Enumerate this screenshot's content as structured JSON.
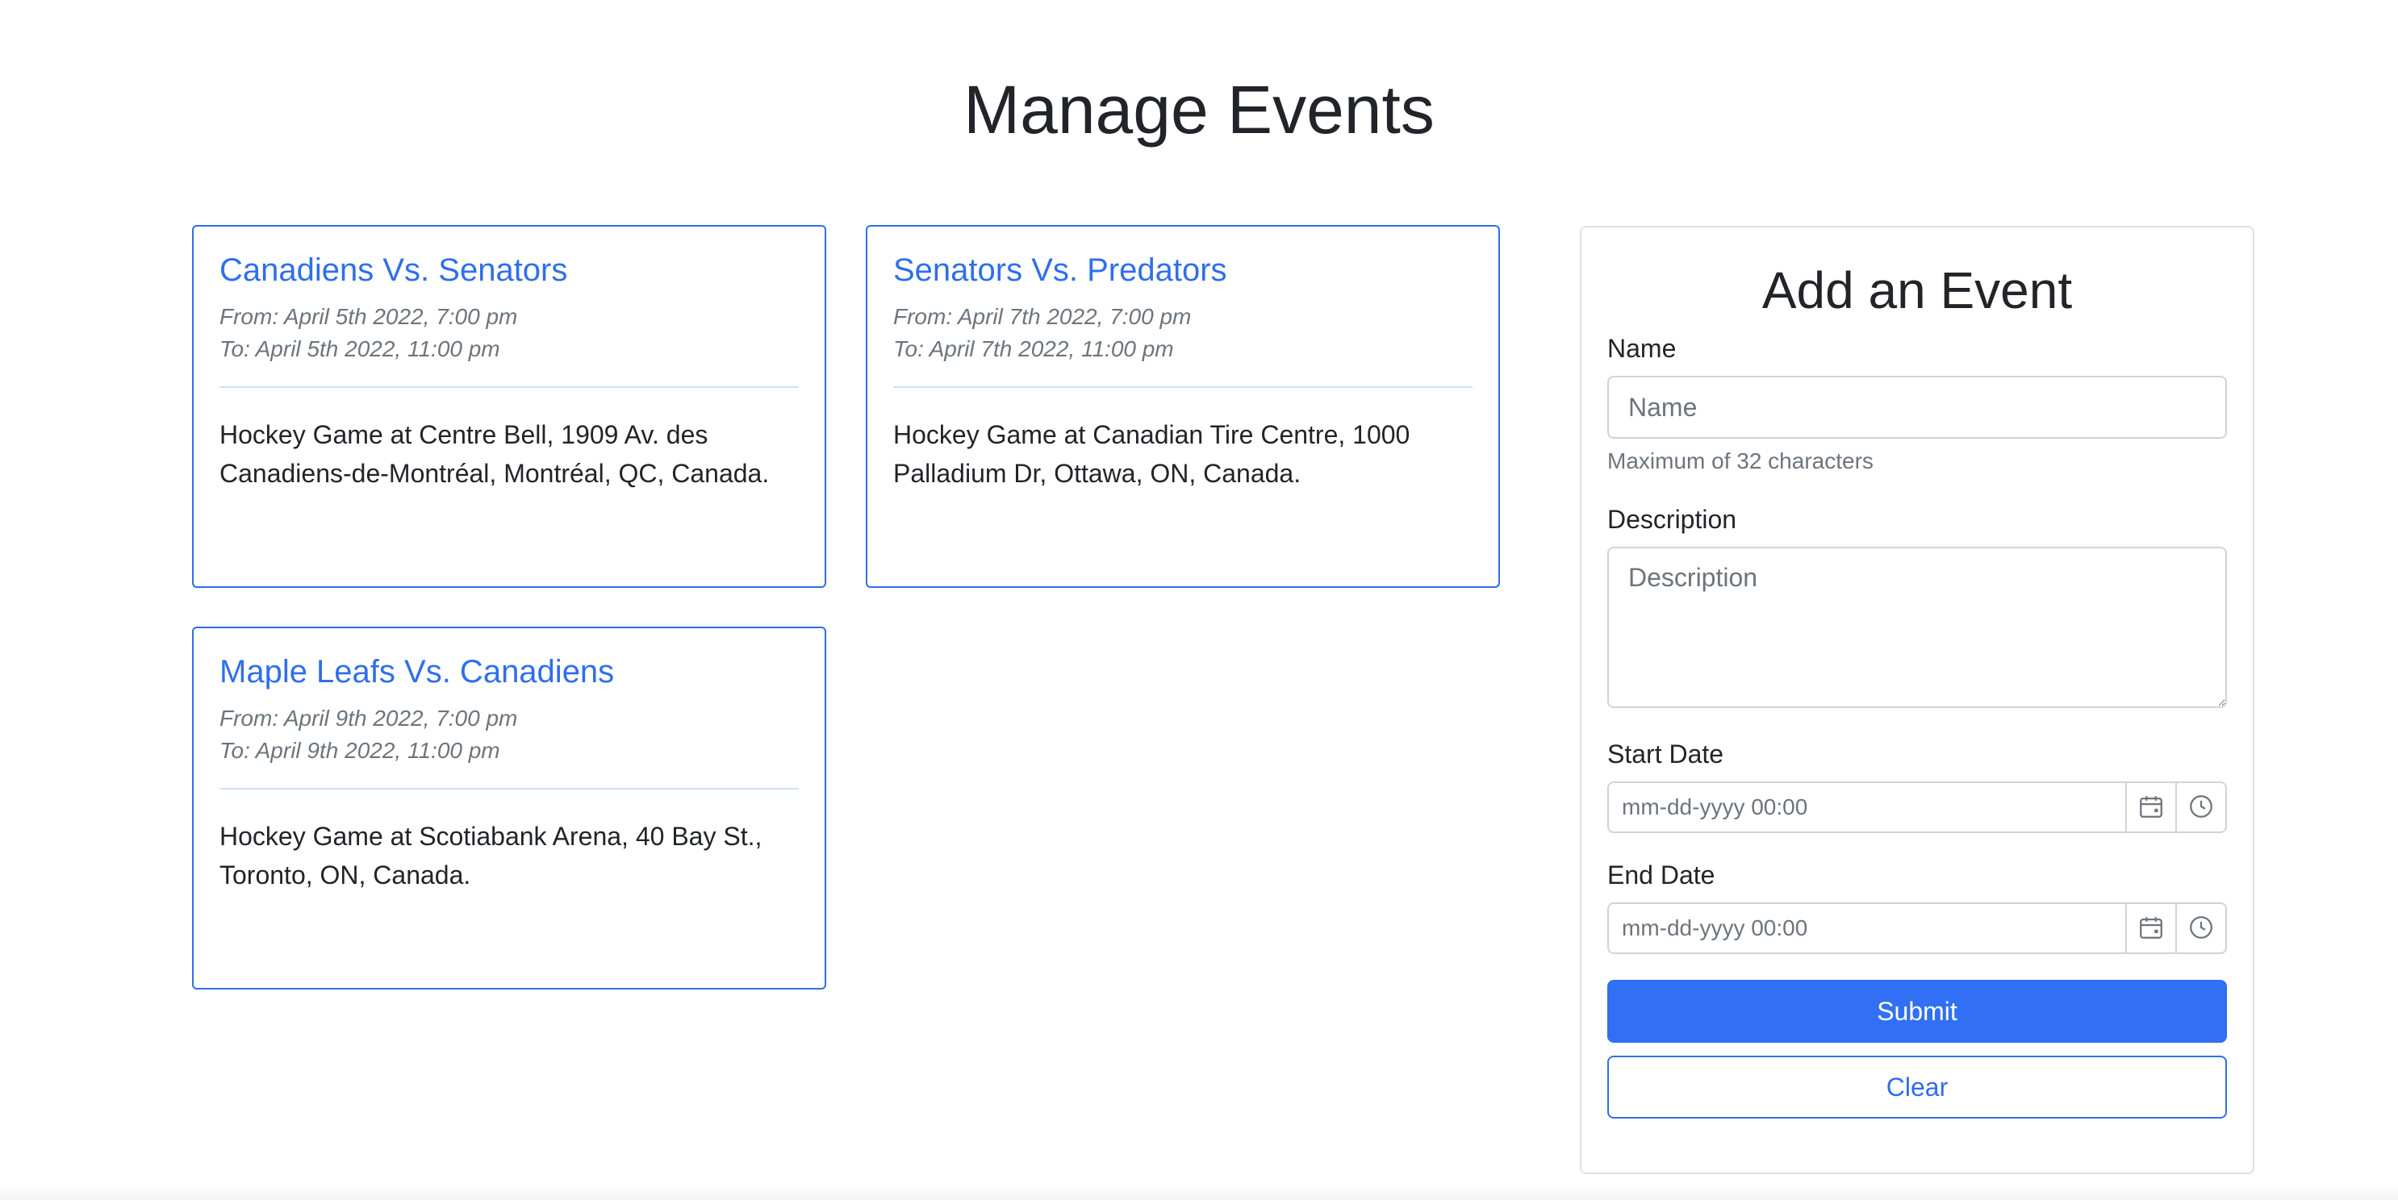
{
  "page": {
    "title": "Manage Events"
  },
  "events": [
    {
      "title": "Canadiens Vs. Senators",
      "from": "From: April 5th 2022, 7:00 pm",
      "to": "To: April 5th 2022, 11:00 pm",
      "description": "Hockey Game at Centre Bell, 1909 Av. des Canadiens-de-Montréal, Montréal, QC, Canada."
    },
    {
      "title": "Senators Vs. Predators",
      "from": "From: April 7th 2022, 7:00 pm",
      "to": "To: April 7th 2022, 11:00 pm",
      "description": "Hockey Game at Canadian Tire Centre, 1000 Palladium Dr, Ottawa, ON, Canada."
    },
    {
      "title": "Maple Leafs Vs. Canadiens",
      "from": "From: April 9th 2022, 7:00 pm",
      "to": "To: April 9th 2022, 11:00 pm",
      "description": "Hockey Game at Scotiabank Arena, 40 Bay St., Toronto, ON, Canada."
    }
  ],
  "form": {
    "title": "Add an Event",
    "name_label": "Name",
    "name_placeholder": "Name",
    "name_help": "Maximum of 32 characters",
    "description_label": "Description",
    "description_placeholder": "Description",
    "start_label": "Start Date",
    "start_placeholder": "mm-dd-yyyy 00:00",
    "end_label": "End Date",
    "end_placeholder": "mm-dd-yyyy 00:00",
    "submit_label": "Submit",
    "clear_label": "Clear"
  },
  "icons": {
    "calendar": "calendar-icon",
    "clock": "clock-icon"
  },
  "colors": {
    "accent": "#2f6fea",
    "primary_button": "#3170f4",
    "muted_text": "#6c757d",
    "border": "#ced4da"
  }
}
